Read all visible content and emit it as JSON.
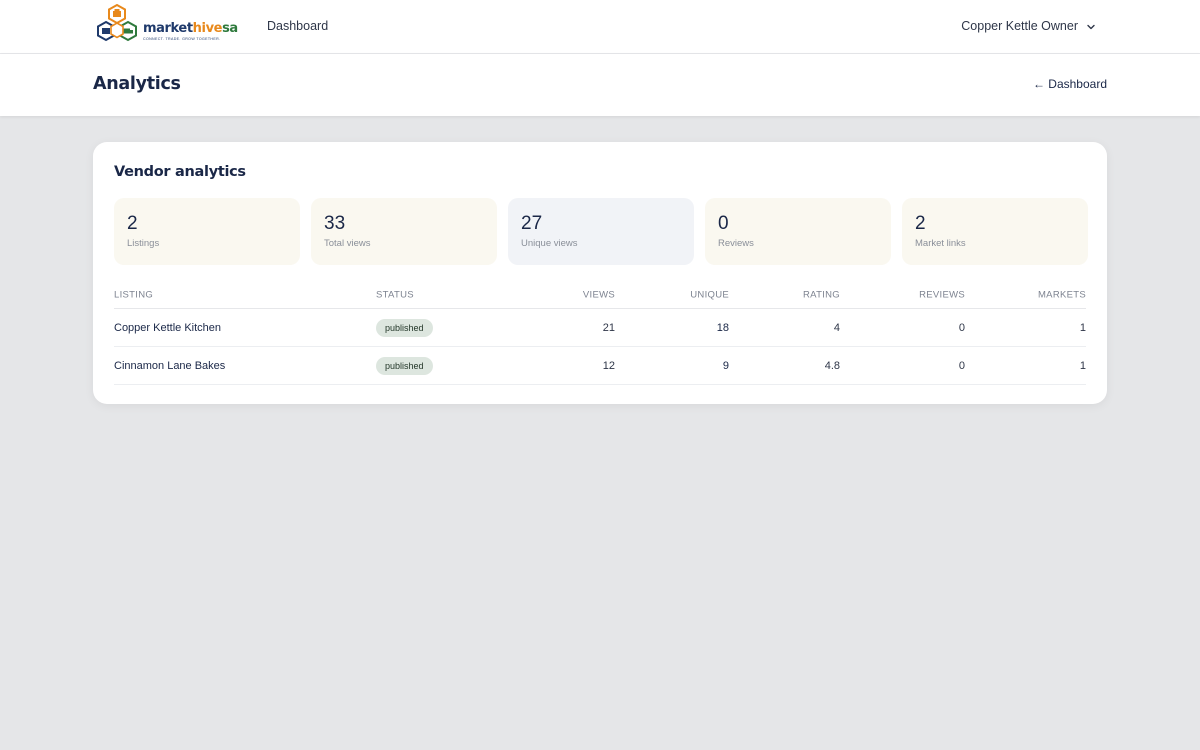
{
  "brand": {
    "word_part1": "market",
    "word_part2": "hive",
    "word_part3": "sa",
    "tagline": "CONNECT. TRADE. GROW TOGETHER.",
    "colors": {
      "navy": "#1f3a6b",
      "orange": "#e8891c",
      "green": "#2f7a3d"
    }
  },
  "nav": {
    "dashboard_label": "Dashboard",
    "user_name": "Copper Kettle Owner",
    "user_menu_icon": "chevron-down-icon"
  },
  "page": {
    "title": "Analytics",
    "back_link": "← Dashboard"
  },
  "card": {
    "title": "Vendor analytics",
    "stats": [
      {
        "value": "2",
        "label": "Listings"
      },
      {
        "value": "33",
        "label": "Total views"
      },
      {
        "value": "27",
        "label": "Unique views"
      },
      {
        "value": "0",
        "label": "Reviews"
      },
      {
        "value": "2",
        "label": "Market links"
      }
    ]
  },
  "table": {
    "headers": {
      "listing": "LISTING",
      "status": "STATUS",
      "views": "VIEWS",
      "unique": "UNIQUE",
      "rating": "RATING",
      "reviews": "REVIEWS",
      "markets": "MARKETS"
    },
    "rows": [
      {
        "listing": "Copper Kettle Kitchen",
        "status": "published",
        "views": "21",
        "unique": "18",
        "rating": "4",
        "reviews": "0",
        "markets": "1"
      },
      {
        "listing": "Cinnamon Lane Bakes",
        "status": "published",
        "views": "12",
        "unique": "9",
        "rating": "4.8",
        "reviews": "0",
        "markets": "1"
      }
    ]
  }
}
